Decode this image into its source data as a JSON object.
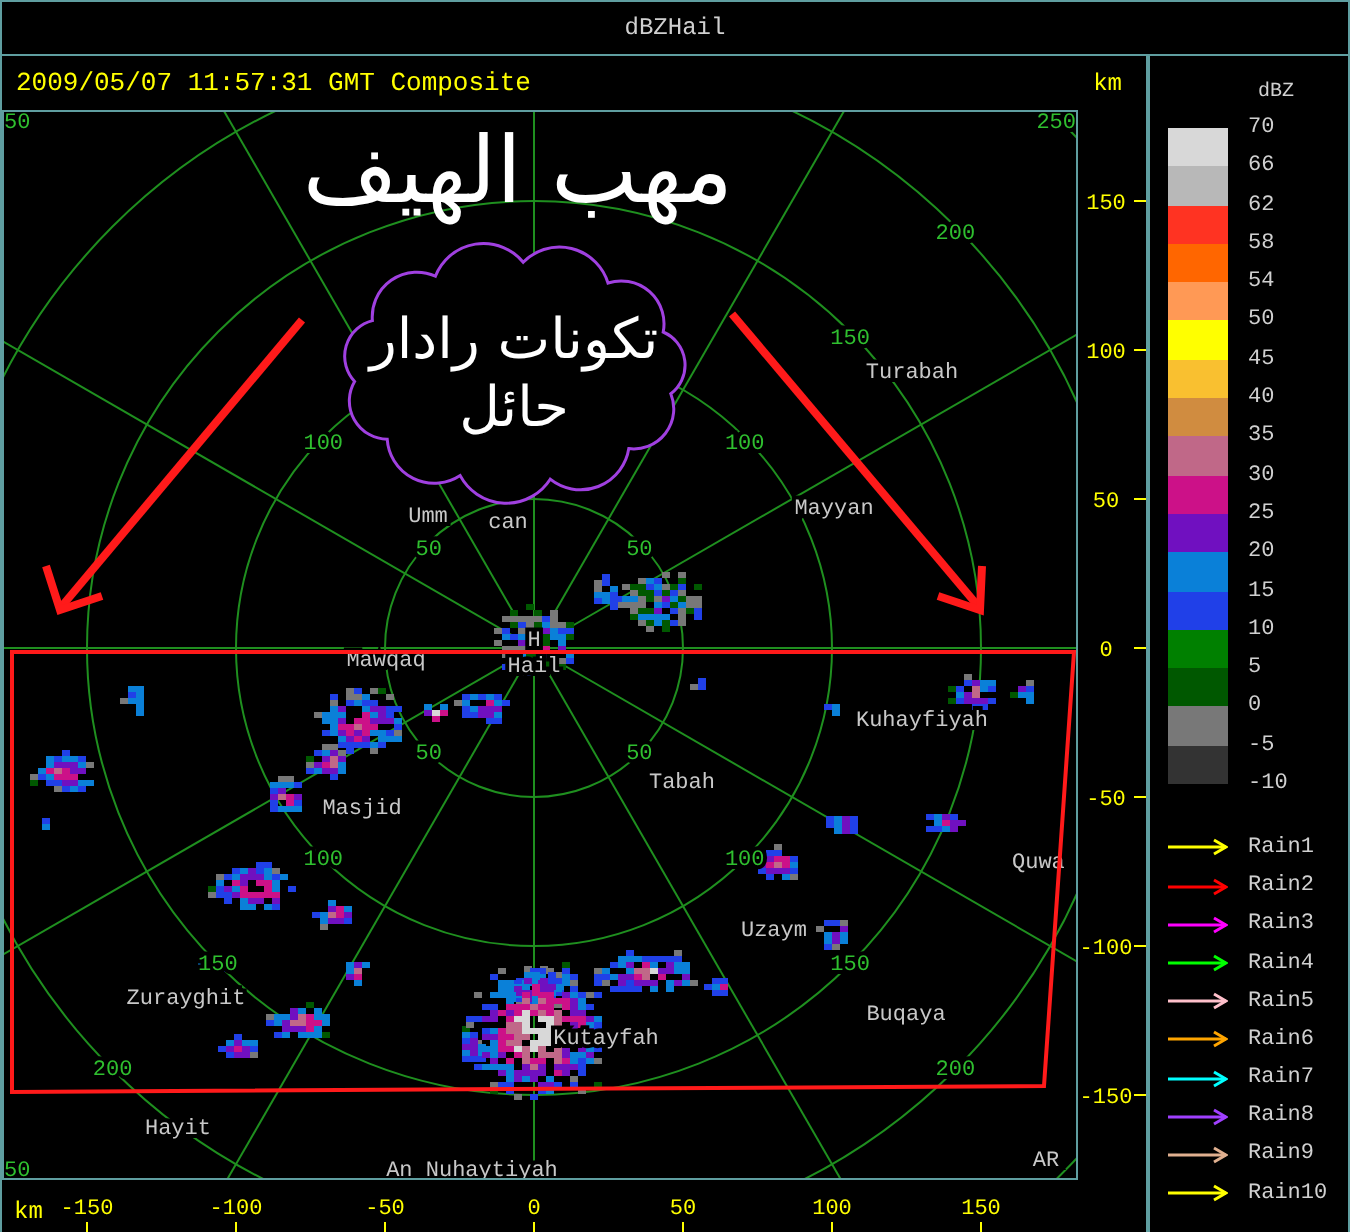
{
  "window": {
    "title": "dBZHail"
  },
  "header": {
    "timestamp": "2009/05/07 11:57:31 GMT Composite",
    "unit": "km"
  },
  "map": {
    "title": "مهب الهيف",
    "callout_lines": [
      "تكونات رادار",
      "حائل"
    ],
    "ring_labels": [
      {
        "text": "50"
      },
      {
        "text": "50"
      },
      {
        "text": "50"
      },
      {
        "text": "50"
      },
      {
        "text": "100"
      },
      {
        "text": "100"
      },
      {
        "text": "100"
      },
      {
        "text": "100"
      },
      {
        "text": "150"
      },
      {
        "text": "150"
      },
      {
        "text": "150"
      },
      {
        "text": "200"
      },
      {
        "text": "200"
      },
      {
        "text": "200"
      },
      {
        "text": "50"
      },
      {
        "text": "250"
      },
      {
        "text": "50"
      }
    ],
    "places": [
      {
        "name": "Turabah"
      },
      {
        "name": "Umm"
      },
      {
        "name": "can"
      },
      {
        "name": "Mayyan"
      },
      {
        "name": "Mawqaq"
      },
      {
        "name": "H"
      },
      {
        "name": "Hail"
      },
      {
        "name": "Kuhayfiyah"
      },
      {
        "name": "Tabah"
      },
      {
        "name": "Masjid"
      },
      {
        "name": "Quwa"
      },
      {
        "name": "Uzaym"
      },
      {
        "name": "Buqaya"
      },
      {
        "name": "Zurayghit"
      },
      {
        "name": "Kutayfah"
      },
      {
        "name": "Hayit"
      },
      {
        "name": "An Nuhaytiyah"
      },
      {
        "name": "AR"
      }
    ],
    "y_axis": {
      "ticks": [
        "150",
        "100",
        "50",
        "0",
        "-50",
        "-100",
        "-150"
      ]
    },
    "x_axis": {
      "unit": "km",
      "ticks": [
        "-150",
        "-100",
        "-50",
        "0",
        "50",
        "100",
        "150"
      ]
    }
  },
  "legend": {
    "title": "dBZ",
    "bins": [
      {
        "color": "#d8d8d8"
      },
      {
        "color": "#b8b8b8"
      },
      {
        "color": "#ff3322"
      },
      {
        "color": "#ff6600"
      },
      {
        "color": "#ff9955"
      },
      {
        "color": "#ffff00"
      },
      {
        "color": "#f9c030"
      },
      {
        "color": "#d08c40"
      },
      {
        "color": "#c06888"
      },
      {
        "color": "#cc1188"
      },
      {
        "color": "#7010c0"
      },
      {
        "color": "#0a80d8"
      },
      {
        "color": "#2040e8"
      },
      {
        "color": "#008000"
      },
      {
        "color": "#005800"
      },
      {
        "color": "#787878"
      },
      {
        "color": "#333333"
      }
    ],
    "labels": [
      "70",
      "66",
      "62",
      "58",
      "54",
      "50",
      "45",
      "40",
      "35",
      "30",
      "25",
      "20",
      "15",
      "10",
      "5",
      "0",
      "-5",
      "-10"
    ],
    "tracks": [
      {
        "label": "Rain1",
        "color": "#ffff00"
      },
      {
        "label": "Rain2",
        "color": "#ff0000"
      },
      {
        "label": "Rain3",
        "color": "#ff00ff"
      },
      {
        "label": "Rain4",
        "color": "#00ff00"
      },
      {
        "label": "Rain5",
        "color": "#ffc0cb"
      },
      {
        "label": "Rain6",
        "color": "#ffa500"
      },
      {
        "label": "Rain7",
        "color": "#00ffff"
      },
      {
        "label": "Rain8",
        "color": "#a040ff"
      },
      {
        "label": "Rain9",
        "color": "#e0b090"
      },
      {
        "label": "Rain10",
        "color": "#ffff00"
      }
    ]
  }
}
